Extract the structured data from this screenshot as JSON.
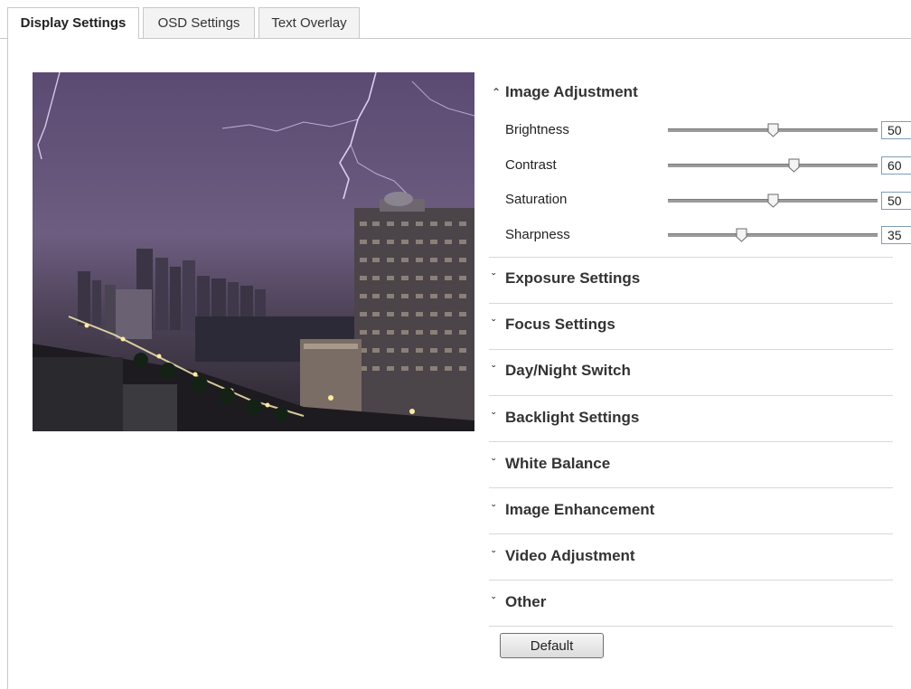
{
  "tabs": [
    {
      "label": "Display Settings",
      "active": true
    },
    {
      "label": "OSD Settings",
      "active": false
    },
    {
      "label": "Text Overlay",
      "active": false
    }
  ],
  "preview": {
    "icon": "camera-live-preview"
  },
  "image_adjustment": {
    "title": "Image Adjustment",
    "expanded_icon": "chevron-up-icon",
    "sliders": [
      {
        "label": "Brightness",
        "value": "50",
        "fraction": 0.5
      },
      {
        "label": "Contrast",
        "value": "60",
        "fraction": 0.6
      },
      {
        "label": "Saturation",
        "value": "50",
        "fraction": 0.5
      },
      {
        "label": "Sharpness",
        "value": "35",
        "fraction": 0.35
      }
    ]
  },
  "sections": [
    {
      "label": "Exposure Settings"
    },
    {
      "label": "Focus Settings"
    },
    {
      "label": "Day/Night Switch"
    },
    {
      "label": "Backlight Settings"
    },
    {
      "label": "White Balance"
    },
    {
      "label": "Image Enhancement"
    },
    {
      "label": "Video Adjustment"
    },
    {
      "label": "Other"
    }
  ],
  "collapsed_icon": "chevron-down-icon",
  "default_button": {
    "label": "Default"
  },
  "colors": {
    "track": "#9b9b9b",
    "value_border": "#7f9db9",
    "divider": "#d8d8d8"
  }
}
